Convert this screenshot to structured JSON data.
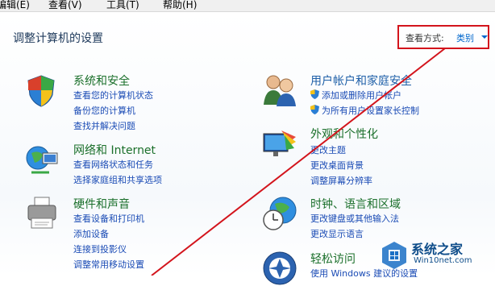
{
  "menu": [
    "编辑(E)",
    "查看(V)",
    "工具(T)",
    "帮助(H)"
  ],
  "page_title": "调整计算机的设置",
  "view_by": {
    "label": "查看方式:",
    "value": "类别"
  },
  "categories": [
    {
      "title": "系统和安全",
      "links": [
        "查看您的计算机状态",
        "备份您的计算机",
        "查找并解决问题"
      ],
      "icon": "system-security-icon"
    },
    {
      "title": "网络和 Internet",
      "links": [
        "查看网络状态和任务",
        "选择家庭组和共享选项"
      ],
      "icon": "network-icon"
    },
    {
      "title": "硬件和声音",
      "links": [
        "查看设备和打印机",
        "添加设备",
        "连接到投影仪",
        "调整常用移动设置"
      ],
      "icon": "printer-icon"
    },
    {
      "title": "用户帐户和家庭安全",
      "links": [
        "添加或删除用户帐户",
        "为所有用户设置家长控制"
      ],
      "icon": "users-icon"
    },
    {
      "title": "外观和个性化",
      "links": [
        "更改主题",
        "更改桌面背景",
        "调整屏幕分辨率"
      ],
      "icon": "appearance-icon"
    },
    {
      "title": "时钟、语言和区域",
      "links": [
        "更改键盘或其他输入法",
        "更改显示语言"
      ],
      "icon": "clock-globe-icon"
    },
    {
      "title": "轻松访问",
      "links": [
        "使用 Windows 建议的设置"
      ],
      "icon": "ease-of-access-icon"
    }
  ],
  "watermark": {
    "name": "系统之家",
    "site": "Win10net.com"
  },
  "colors": {
    "annotation": "#d3141c",
    "category_title": "#1a6f2a",
    "link": "#1a4bb5"
  }
}
